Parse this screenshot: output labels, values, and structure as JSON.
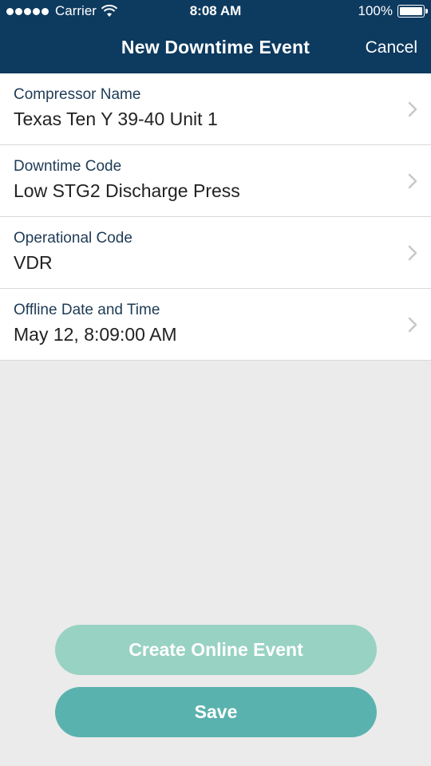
{
  "status_bar": {
    "carrier": "Carrier",
    "time": "8:08 AM",
    "battery": "100%",
    "icons": [
      "signal-dots-icon",
      "wifi-icon",
      "battery-icon"
    ]
  },
  "nav": {
    "title": "New Downtime Event",
    "cancel_label": "Cancel",
    "background": "#0d3a5f"
  },
  "form": {
    "rows": [
      {
        "label": "Compressor Name",
        "value": "Texas Ten Y 39-40 Unit 1"
      },
      {
        "label": "Downtime Code",
        "value": "Low STG2 Discharge Press"
      },
      {
        "label": "Operational Code",
        "value": "VDR"
      },
      {
        "label": "Offline Date and Time",
        "value": "May 12, 8:09:00 AM"
      }
    ]
  },
  "actions": {
    "create_online_label": "Create Online Event",
    "save_label": "Save",
    "create_online_color": "#98d2c2",
    "save_color": "#5ab2ae"
  }
}
